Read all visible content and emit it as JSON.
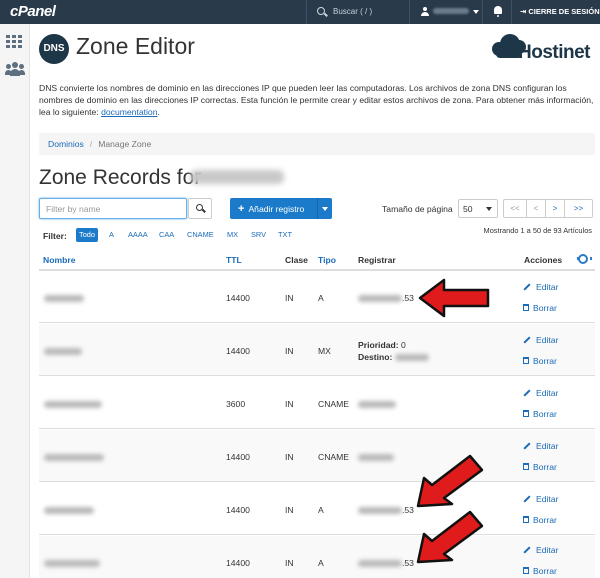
{
  "topbar": {
    "logo": "cPanel",
    "search_placeholder": "Buscar ( / )",
    "logout": "CIERRE DE SESIÓN"
  },
  "header": {
    "badge": "DNS",
    "title": "Zone Editor",
    "brand": "Hostinet"
  },
  "description": {
    "text": "DNS convierte los nombres de dominio en las direcciones IP que pueden leer las computadoras. Los archivos de zona DNS configuran los nombres de dominio en las direcciones IP correctas. Esta función le permite crear y editar estos archivos de zona. Para obtener más información, lea lo siguiente: ",
    "link": "documentation",
    "end": "."
  },
  "breadcrumb": {
    "root": "Dominios",
    "sep": "/",
    "current": "Manage Zone"
  },
  "zone_title": "Zone Records for",
  "controls": {
    "filter_placeholder": "Filter by name",
    "add_label": "Añadir registro",
    "add_plus": "+",
    "page_size_label": "Tamaño de página",
    "page_size_value": "50",
    "pager": [
      "<<",
      "<",
      ">",
      ">>"
    ],
    "showing": "Mostrando 1 a 50 de 93 Artículos"
  },
  "filters": {
    "label": "Filter:",
    "tabs": [
      "Todo",
      "A",
      "AAAA",
      "CAA",
      "CNAME",
      "MX",
      "SRV",
      "TXT"
    ]
  },
  "table": {
    "headers": {
      "name": "Nombre",
      "ttl": "TTL",
      "clase": "Clase",
      "tipo": "Tipo",
      "registrar": "Registrar",
      "acciones": "Acciones"
    },
    "actions": {
      "edit": "Editar",
      "delete": "Borrar"
    },
    "rows": [
      {
        "ttl": "14400",
        "clase": "IN",
        "tipo": "A",
        "reg_suffix": ".53"
      },
      {
        "ttl": "14400",
        "clase": "IN",
        "tipo": "MX",
        "prioridad_label": "Prioridad:",
        "prioridad": "0",
        "destino_label": "Destino:"
      },
      {
        "ttl": "3600",
        "clase": "IN",
        "tipo": "CNAME"
      },
      {
        "ttl": "14400",
        "clase": "IN",
        "tipo": "CNAME"
      },
      {
        "ttl": "14400",
        "clase": "IN",
        "tipo": "A",
        "reg_suffix": ".53"
      },
      {
        "ttl": "14400",
        "clase": "IN",
        "tipo": "A",
        "reg_suffix": ".53"
      }
    ]
  },
  "colors": {
    "topbar": "#293a4a",
    "primary": "#1b7bca",
    "link": "#1a6bb8",
    "arrow": "#e01b1b"
  }
}
